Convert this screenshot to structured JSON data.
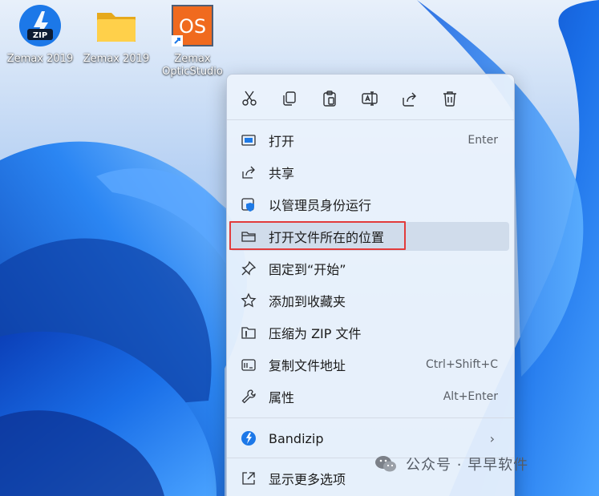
{
  "desktop": {
    "icons": [
      {
        "label": "Zemax 2019",
        "icon": "bandizip-zip-icon",
        "badge": "ZIP"
      },
      {
        "label": "Zemax 2019",
        "icon": "folder-icon"
      },
      {
        "label_line1": "Zemax",
        "label_line2": "OpticStudio",
        "icon": "opticstudio-shortcut-icon",
        "badge": "OS"
      }
    ]
  },
  "context_menu": {
    "toolbar": [
      "cut-icon",
      "copy-icon",
      "paste-icon",
      "rename-icon",
      "share-icon",
      "delete-icon"
    ],
    "items": [
      {
        "label": "打开",
        "shortcut": "Enter",
        "icon": "open-window-icon"
      },
      {
        "label": "共享",
        "icon": "share-icon"
      },
      {
        "label": "以管理员身份运行",
        "icon": "shield-icon"
      },
      {
        "label": "打开文件所在的位置",
        "icon": "folder-outline-icon",
        "highlighted": true
      },
      {
        "label": "固定到“开始”",
        "icon": "pin-icon"
      },
      {
        "label": "添加到收藏夹",
        "icon": "star-icon"
      },
      {
        "label": "压缩为 ZIP 文件",
        "icon": "zip-file-icon"
      },
      {
        "label": "复制文件地址",
        "shortcut": "Ctrl+Shift+C",
        "icon": "copy-path-icon"
      },
      {
        "label": "属性",
        "shortcut": "Alt+Enter",
        "icon": "wrench-icon"
      },
      {
        "label": "Bandizip",
        "icon": "bandizip-icon",
        "submenu": true
      },
      {
        "label": "显示更多选项",
        "icon": "more-options-icon"
      }
    ]
  },
  "watermark": {
    "text": "公众号 · 早早软件"
  },
  "colors": {
    "highlight_border": "#e23b3b",
    "wallpaper_blue": "#1f6fe0"
  }
}
